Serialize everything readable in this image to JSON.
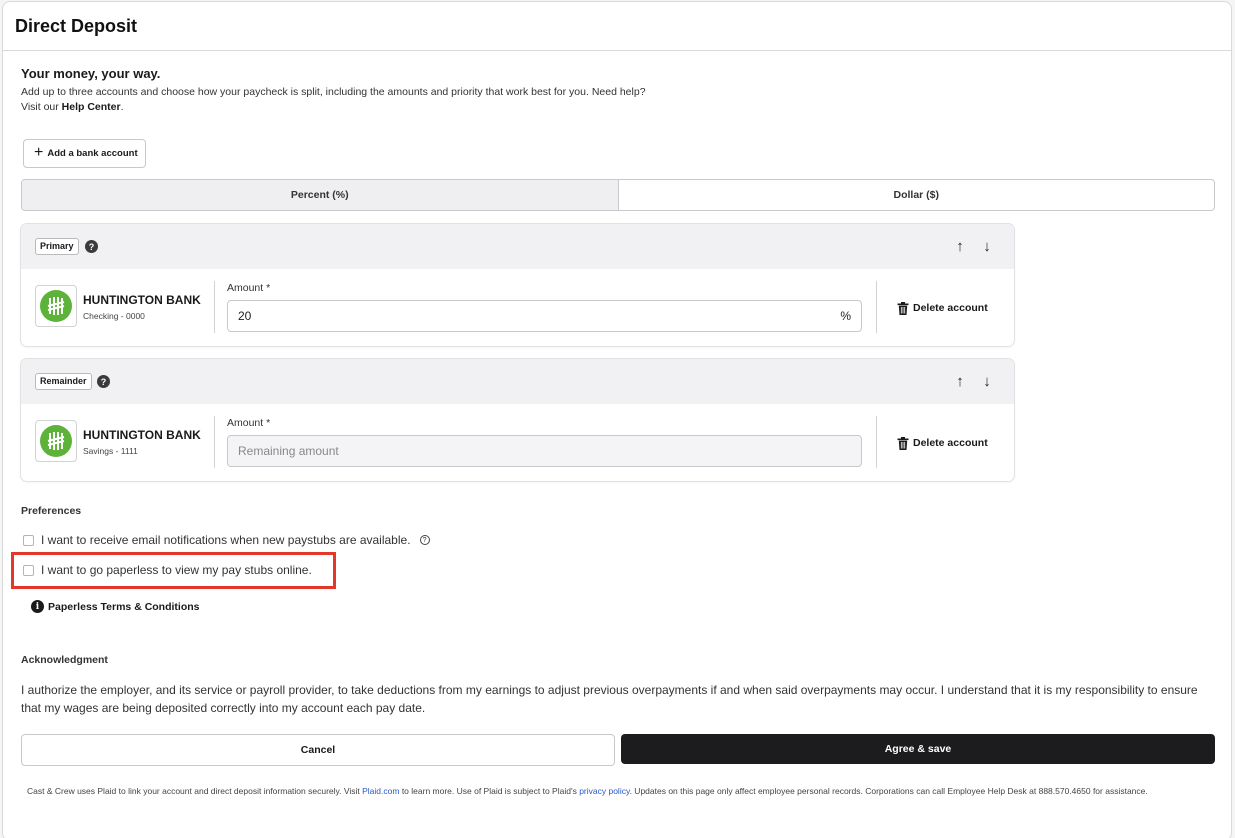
{
  "header": {
    "title": "Direct Deposit"
  },
  "intro": {
    "title": "Your money, your way.",
    "text_line1": "Add up to three accounts and choose how your paycheck is split, including the amounts and priority that work best for you. Need help?",
    "text_visit": "Visit our ",
    "help_link": "Help Center",
    "text_end": "."
  },
  "add_bank": {
    "icon": "plus-icon",
    "label": "Add a bank account"
  },
  "split_mode": {
    "options": [
      "Percent (%)",
      "Dollar ($)"
    ],
    "selected": "Percent (%)"
  },
  "accounts": [
    {
      "tag": "Primary",
      "bank_name": "HUNTINGTON BANK",
      "account": "Checking - 0000",
      "amount_label": "Amount *",
      "amount_value": "20",
      "amount_suffix": "%",
      "delete_label": "Delete account"
    },
    {
      "tag": "Remainder",
      "bank_name": "HUNTINGTON BANK",
      "account": "Savings - 1111",
      "amount_label": "Amount *",
      "amount_placeholder": "Remaining amount",
      "delete_label": "Delete account"
    }
  ],
  "preferences": {
    "title": "Preferences",
    "email_label": "I want to receive email notifications when new paystubs are available.",
    "paperless_label": "I want to go paperless to view my pay stubs online.",
    "terms_label": "Paperless Terms & Conditions"
  },
  "acknowledgment": {
    "title": "Acknowledgment",
    "text": "I authorize the employer, and its service or payroll provider, to take deductions from my earnings to adjust previous overpayments if and when said overpayments may occur. I understand that it is my responsibility to ensure that my wages are being deposited correctly into my account each pay date."
  },
  "actions": {
    "cancel": "Cancel",
    "agree": "Agree & save"
  },
  "footer": {
    "part1": "Cast & Crew uses Plaid to link your account and direct deposit information securely. Visit ",
    "plaid_link": "Plaid.com",
    "part2": " to learn more. Use of Plaid is subject to Plaid's ",
    "privacy_link": "privacy policy",
    "part3": ". Updates on this page only affect employee personal records. Corporations can call Employee Help Desk at 888.570.4650 for assistance."
  },
  "colors": {
    "brand_green": "#5db33a",
    "highlight_red": "#e5362a",
    "primary_dark": "#1c1c1e"
  }
}
